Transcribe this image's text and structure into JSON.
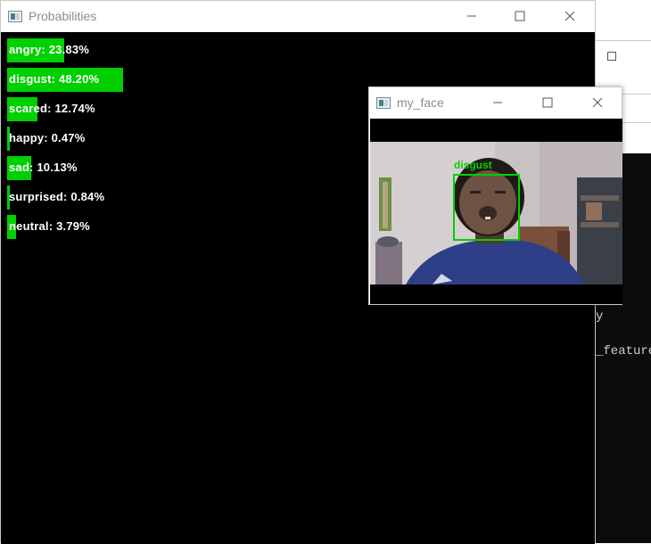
{
  "background": {
    "right_lines": [
      "y",
      "_feature"
    ]
  },
  "prob_window": {
    "title": "Probabilities",
    "bar_color": "#00d000",
    "bars": [
      {
        "label": "angry: 23.83%",
        "value": 23.83
      },
      {
        "label": "disgust: 48.20%",
        "value": 48.2
      },
      {
        "label": "scared: 12.74%",
        "value": 12.74
      },
      {
        "label": "happy: 0.47%",
        "value": 0.47
      },
      {
        "label": "sad: 10.13%",
        "value": 10.13
      },
      {
        "label": "surprised: 0.84%",
        "value": 0.84
      },
      {
        "label": "neutral: 3.79%",
        "value": 3.79
      }
    ]
  },
  "face_window": {
    "title": "my_face",
    "detection_label": "disgust",
    "detection_color": "#00d000"
  }
}
